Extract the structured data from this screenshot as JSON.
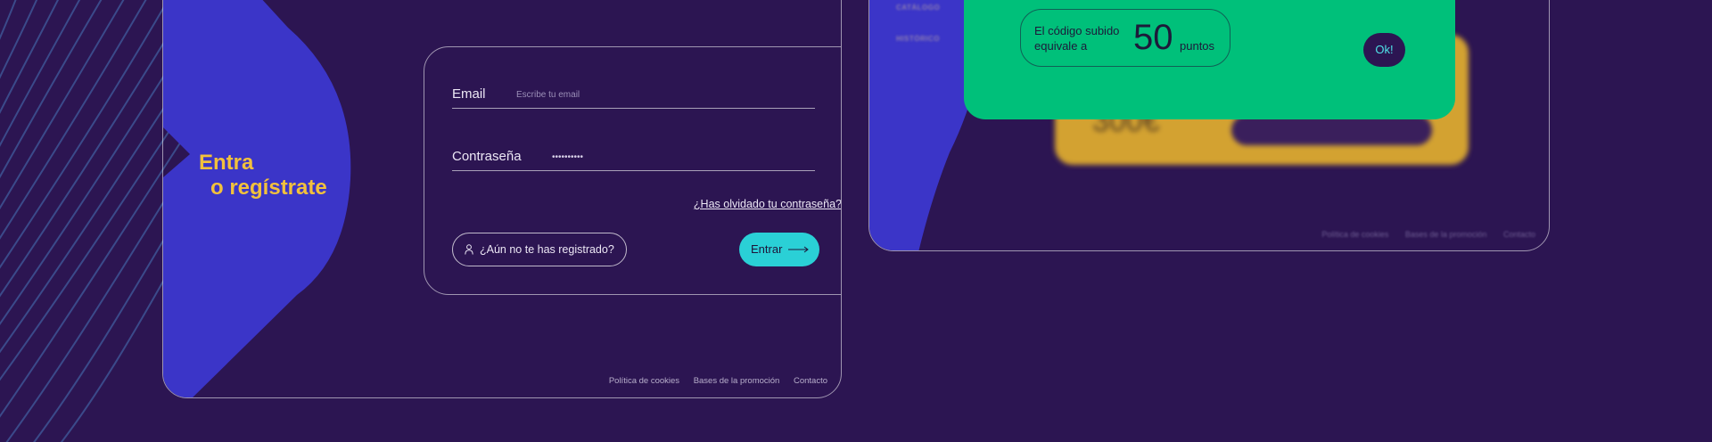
{
  "colors": {
    "background": "#2c1552",
    "brand_blue": "#3b35c8",
    "accent_yellow": "#f2c13c",
    "accent_cyan": "#2ad0d6",
    "modal_green": "#00c07a",
    "gold_card": "#d3a231"
  },
  "login": {
    "hero_line1": "Entra",
    "hero_line2": "o regístrate",
    "email_label": "Email",
    "email_placeholder": "Escribe tu email",
    "password_label": "Contraseña",
    "password_value": "••••••••••",
    "forgot_link": "¿Has olvidado tu contraseña?",
    "register_button": "¿Aún no te has registrado?",
    "register_icon": "user-icon",
    "enter_button": "Entrar",
    "enter_icon": "arrow-right-icon"
  },
  "footer": {
    "links": [
      "Política de cookies",
      "Bases de la promoción",
      "Contacto"
    ]
  },
  "background_card": {
    "nav_items": [
      "CATÁLOGO",
      "HISTÓRICO"
    ],
    "price": "300€",
    "footer_links": [
      "Política de cookies",
      "Bases de la promoción",
      "Contacto"
    ]
  },
  "modal": {
    "message": "El código subido equivale a",
    "points": "50",
    "points_unit": "puntos",
    "ok_button": "Ok!"
  }
}
